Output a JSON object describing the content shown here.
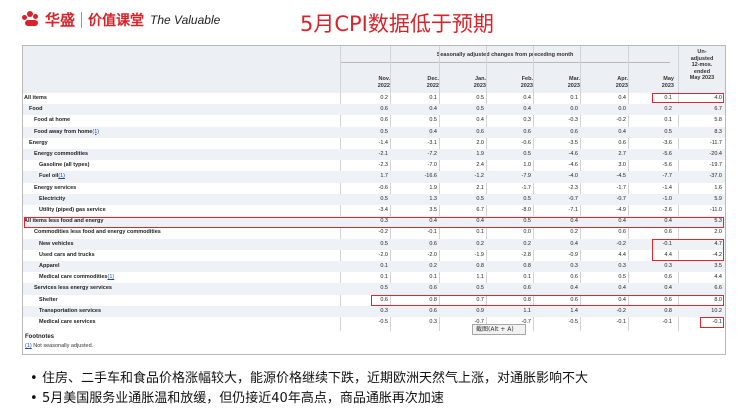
{
  "header": {
    "logo_cn": "华盛",
    "logo_cn2": "价值课堂",
    "logo_en": "The Valuable",
    "title": "5月CPI数据低于预期"
  },
  "table": {
    "group_header": "Seasonally adjusted changes from preceding month",
    "columns": [
      {
        "line1": "Nov.",
        "line2": "2022"
      },
      {
        "line1": "Dec.",
        "line2": "2022"
      },
      {
        "line1": "Jan.",
        "line2": "2023"
      },
      {
        "line1": "Feb.",
        "line2": "2023"
      },
      {
        "line1": "Mar.",
        "line2": "2023"
      },
      {
        "line1": "Apr.",
        "line2": "2023"
      },
      {
        "line1": "May",
        "line2": "2023"
      }
    ],
    "last_col": [
      "Un-",
      "adjusted",
      "12-mos.",
      "ended",
      "May 2023"
    ],
    "rows": [
      {
        "label": "All items",
        "indent": 0,
        "bold": true,
        "vals": [
          "0.2",
          "0.1",
          "0.5",
          "0.4",
          "0.1",
          "0.4",
          "0.1"
        ],
        "last": "4.0"
      },
      {
        "label": "Food",
        "indent": 1,
        "bold": true,
        "vals": [
          "0.6",
          "0.4",
          "0.5",
          "0.4",
          "0.0",
          "0.0",
          "0.2"
        ],
        "last": "6.7"
      },
      {
        "label": "Food at home",
        "indent": 2,
        "bold": true,
        "vals": [
          "0.6",
          "0.5",
          "0.4",
          "0.3",
          "-0.3",
          "-0.2",
          "0.1"
        ],
        "last": "5.8"
      },
      {
        "label": "Food away from home",
        "fn": "(1)",
        "indent": 2,
        "bold": true,
        "vals": [
          "0.5",
          "0.4",
          "0.6",
          "0.6",
          "0.6",
          "0.4",
          "0.5"
        ],
        "last": "8.3"
      },
      {
        "label": "Energy",
        "indent": 1,
        "bold": true,
        "vals": [
          "-1.4",
          "-3.1",
          "2.0",
          "-0.6",
          "-3.5",
          "0.6",
          "-3.6"
        ],
        "last": "-11.7"
      },
      {
        "label": "Energy commodities",
        "indent": 2,
        "bold": true,
        "vals": [
          "-2.1",
          "-7.2",
          "1.9",
          "0.5",
          "-4.6",
          "2.7",
          "-5.6"
        ],
        "last": "-20.4"
      },
      {
        "label": "Gasoline (all types)",
        "indent": 3,
        "bold": true,
        "vals": [
          "-2.3",
          "-7.0",
          "2.4",
          "1.0",
          "-4.6",
          "3.0",
          "-5.6"
        ],
        "last": "-19.7"
      },
      {
        "label": "Fuel oil",
        "fn": "(1)",
        "indent": 3,
        "bold": true,
        "vals": [
          "1.7",
          "-16.6",
          "-1.2",
          "-7.9",
          "-4.0",
          "-4.5",
          "-7.7"
        ],
        "last": "-37.0"
      },
      {
        "label": "Energy services",
        "indent": 2,
        "bold": true,
        "vals": [
          "-0.6",
          "1.9",
          "2.1",
          "-1.7",
          "-2.3",
          "-1.7",
          "-1.4"
        ],
        "last": "1.6"
      },
      {
        "label": "Electricity",
        "indent": 3,
        "bold": true,
        "vals": [
          "0.5",
          "1.3",
          "0.5",
          "0.5",
          "-0.7",
          "-0.7",
          "-1.0"
        ],
        "last": "5.9"
      },
      {
        "label": "Utility (piped) gas service",
        "indent": 3,
        "bold": true,
        "vals": [
          "-3.4",
          "3.5",
          "6.7",
          "-8.0",
          "-7.1",
          "-4.9",
          "-2.6"
        ],
        "last": "-11.0"
      },
      {
        "label": "All items less food and energy",
        "indent": 0,
        "bold": true,
        "vals": [
          "0.3",
          "0.4",
          "0.4",
          "0.5",
          "0.4",
          "0.4",
          "0.4"
        ],
        "last": "5.3"
      },
      {
        "label": "Commodities less food and energy commodities",
        "indent": 2,
        "bold": true,
        "vals": [
          "-0.2",
          "-0.1",
          "0.1",
          "0.0",
          "0.2",
          "0.6",
          "0.6"
        ],
        "last": "2.0"
      },
      {
        "label": "New vehicles",
        "indent": 3,
        "bold": true,
        "vals": [
          "0.5",
          "0.6",
          "0.2",
          "0.2",
          "0.4",
          "-0.2",
          "-0.1"
        ],
        "last": "4.7"
      },
      {
        "label": "Used cars and trucks",
        "indent": 3,
        "bold": true,
        "vals": [
          "-2.0",
          "-2.0",
          "-1.9",
          "-2.8",
          "-0.9",
          "4.4",
          "4.4"
        ],
        "last": "-4.2"
      },
      {
        "label": "Apparel",
        "indent": 3,
        "bold": true,
        "vals": [
          "0.1",
          "0.2",
          "0.8",
          "0.8",
          "0.3",
          "0.3",
          "0.3"
        ],
        "last": "3.5"
      },
      {
        "label": "Medical care commodities",
        "fn": "(1)",
        "indent": 3,
        "bold": true,
        "vals": [
          "0.1",
          "0.1",
          "1.1",
          "0.1",
          "0.6",
          "0.5",
          "0.6"
        ],
        "last": "4.4"
      },
      {
        "label": "Services less energy services",
        "indent": 2,
        "bold": true,
        "vals": [
          "0.5",
          "0.6",
          "0.5",
          "0.6",
          "0.4",
          "0.4",
          "0.4"
        ],
        "last": "6.6"
      },
      {
        "label": "Shelter",
        "indent": 3,
        "bold": true,
        "vals": [
          "0.6",
          "0.8",
          "0.7",
          "0.8",
          "0.6",
          "0.4",
          "0.6"
        ],
        "last": "8.0"
      },
      {
        "label": "Transportation services",
        "indent": 3,
        "bold": true,
        "vals": [
          "0.3",
          "0.6",
          "0.9",
          "1.1",
          "1.4",
          "-0.2",
          "0.8"
        ],
        "last": "10.2"
      },
      {
        "label": "Medical care services",
        "indent": 3,
        "bold": true,
        "vals": [
          "-0.5",
          "0.3",
          "-0.7",
          "-0.7",
          "-0.5",
          "-0.1",
          "-0.1"
        ],
        "last": "-0.1"
      }
    ],
    "footnotes_title": "Footnotes",
    "footnote_marker": "(1)",
    "footnote_text": " Not seasonally adjusted."
  },
  "tooltip": "截图(Alt + A)",
  "bullets": [
    "住房、二手车和食品价格涨幅较大，能源价格继续下跌，近期欧洲天然气上涨，对通胀影响不大",
    "5月美国服务业通胀温和放缓，但仍接近40年高点，商品通胀再次加速"
  ],
  "colors": {
    "accent": "#d8232a",
    "highlight_box": "#e5252a",
    "alt_row": "#eef1f5"
  }
}
